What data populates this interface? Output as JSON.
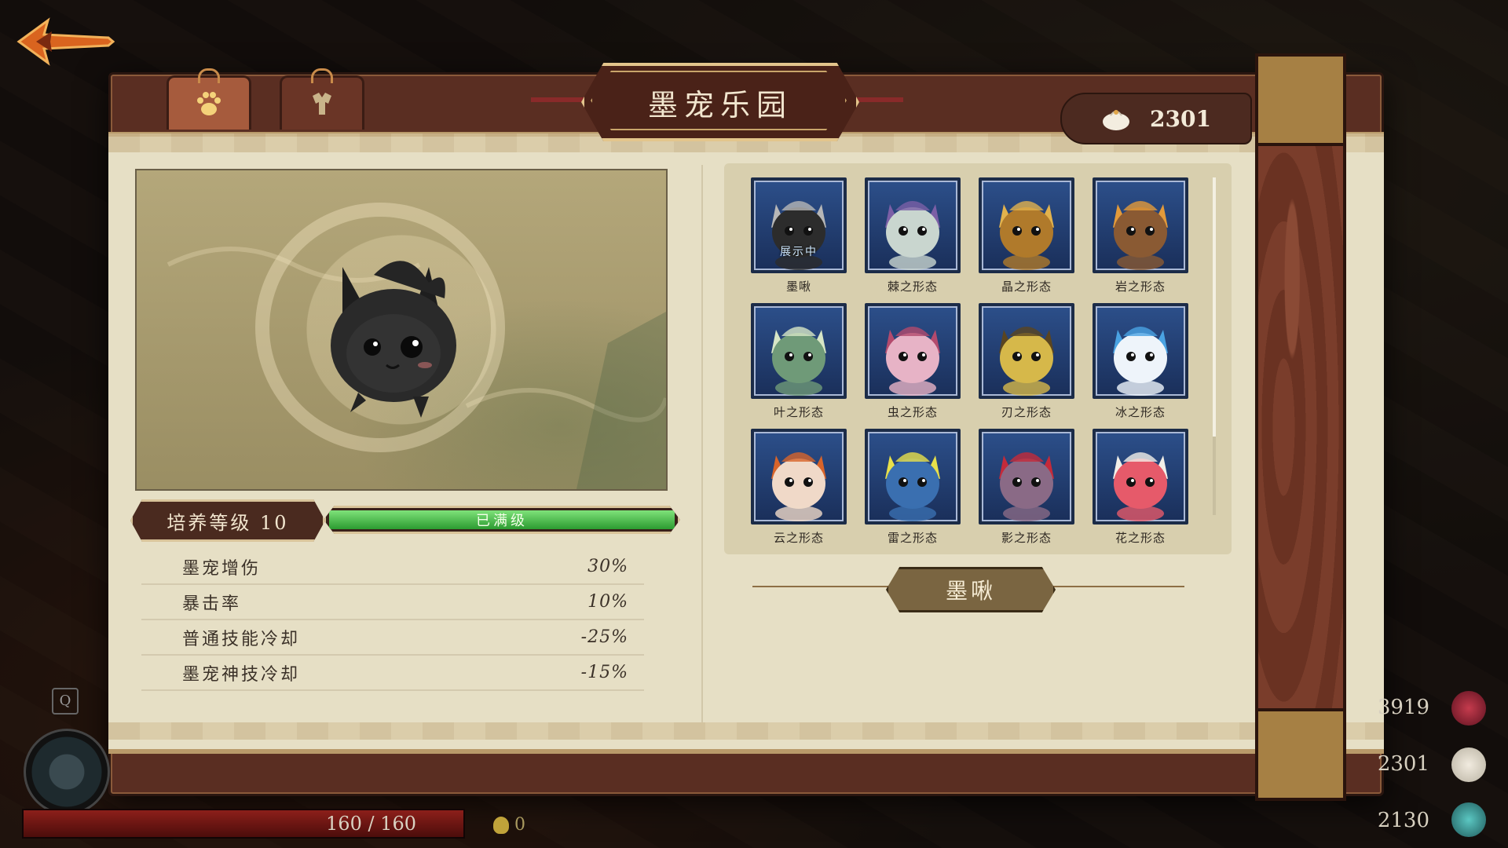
{
  "title": "墨宠乐园",
  "tabs": [
    {
      "icon": "paw-icon",
      "active": true
    },
    {
      "icon": "outfit-icon",
      "active": false
    }
  ],
  "currency": {
    "icon": "bun-icon",
    "value": "2301"
  },
  "level": {
    "label": "培养等级 10",
    "status": "已满级",
    "progress": 1.0
  },
  "stats": [
    {
      "name": "墨宠增伤",
      "value": "30%"
    },
    {
      "name": "暴击率",
      "value": "10%"
    },
    {
      "name": "普通技能冷却",
      "value": "-25%"
    },
    {
      "name": "墨宠神技冷却",
      "value": "-15%"
    }
  ],
  "pets": [
    {
      "name": "墨啾",
      "color": "#2c2c2c",
      "accent": "#b7b7b7",
      "showing": "展示中"
    },
    {
      "name": "棘之形态",
      "color": "#c9d6cf",
      "accent": "#7b5fa6"
    },
    {
      "name": "晶之形态",
      "color": "#b07a2b",
      "accent": "#e2b24d"
    },
    {
      "name": "岩之形态",
      "color": "#8a5a33",
      "accent": "#e39a3a"
    },
    {
      "name": "叶之形态",
      "color": "#6f9a78",
      "accent": "#d7e6c6"
    },
    {
      "name": "虫之形态",
      "color": "#e7b3c6",
      "accent": "#b34a6d"
    },
    {
      "name": "刃之形态",
      "color": "#d6b84a",
      "accent": "#5a4520"
    },
    {
      "name": "冰之形态",
      "color": "#eef4fa",
      "accent": "#4aa3e3"
    },
    {
      "name": "云之形态",
      "color": "#f0d9c8",
      "accent": "#d8642a"
    },
    {
      "name": "雷之形态",
      "color": "#3a6fb0",
      "accent": "#e8e04a"
    },
    {
      "name": "影之形态",
      "color": "#8a6a86",
      "accent": "#c42a3a"
    },
    {
      "name": "花之形态",
      "color": "#e65a6a",
      "accent": "#f2efe8"
    }
  ],
  "selected_pet": "墨啾",
  "hud": {
    "hp": "160 / 160",
    "hp_fraction": 1.0,
    "gold": "0",
    "resources": [
      "3919",
      "2301",
      "2130"
    ],
    "key_hint": "Q"
  }
}
